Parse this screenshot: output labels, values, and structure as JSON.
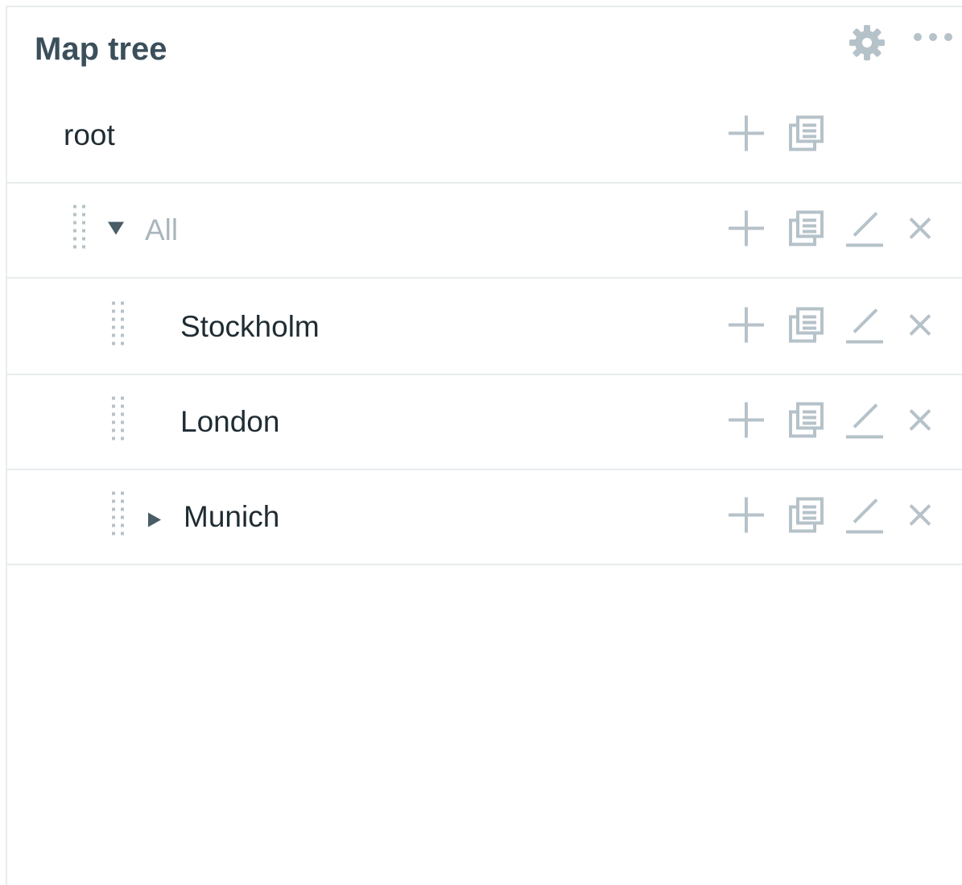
{
  "header": {
    "title": "Map tree",
    "icons": [
      "gear-icon",
      "more-icon"
    ]
  },
  "tree": {
    "root": {
      "label": "root"
    },
    "items": [
      {
        "label": "All",
        "state": "expanded",
        "muted": true
      },
      {
        "label": "Stockholm",
        "state": "leaf"
      },
      {
        "label": "London",
        "state": "leaf"
      },
      {
        "label": "Munich",
        "state": "collapsed"
      }
    ]
  },
  "colors": {
    "icon": "#b6c2c9",
    "title": "#3b4f5b",
    "divider": "#e8ecee",
    "muted_text": "#a9b6bd"
  }
}
